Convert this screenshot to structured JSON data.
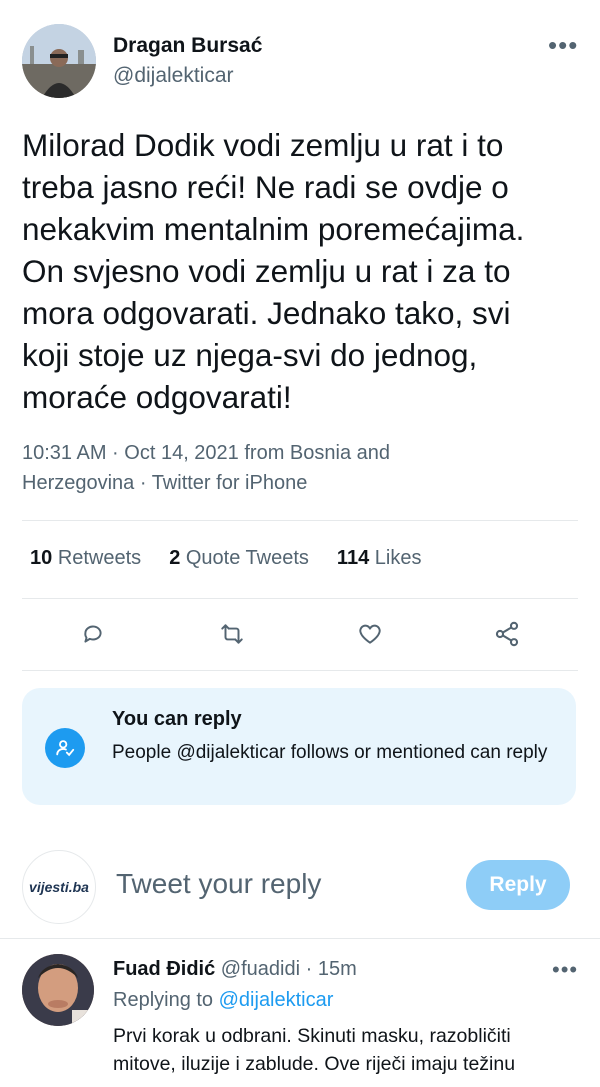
{
  "author": {
    "name": "Dragan Bursać",
    "handle": "@dijalekticar"
  },
  "tweet": {
    "text": "Milorad Dodik vodi zemlju u rat i to\ntreba jasno reći! Ne radi se ovdje o\nnekakvim mentalnim poremećajima.\nOn svjesno vodi zemlju u rat i za to\nmora odgovarati. Jednako tako, svi\nkoji stoje uz njega-svi do jednog,\nmoraće odgovarati!",
    "meta": "10:31 AM · Oct 14, 2021 from Bosnia and\nHerzegovina · Twitter for iPhone"
  },
  "stats": {
    "retweets_count": "10",
    "retweets_label": "Retweets",
    "quotes_count": "2",
    "quotes_label": "Quote Tweets",
    "likes_count": "114",
    "likes_label": "Likes"
  },
  "icons": {
    "reply": "reply-icon",
    "retweet": "retweet-icon",
    "like": "heart-icon",
    "share": "share-icon",
    "more": "more-icon"
  },
  "reply_permissions": {
    "title": "You can reply",
    "description": "People @dijalekticar follows or mentioned can reply"
  },
  "composer": {
    "logo_text": "vijesti.ba",
    "placeholder": "Tweet your reply",
    "button_label": "Reply"
  },
  "reply": {
    "name": "Fuad Đidić",
    "handle": "@fuadidi",
    "time": "· 15m",
    "replying_prefix": "Replying to",
    "replying_to": "@dijalekticar",
    "text": "Prvi korak u odbrani. Skinuti masku, razobličiti\nmitove, iluzije i zablude. Ove riječi imaju težinu"
  },
  "colors": {
    "accent": "#1d9bf0",
    "muted": "#536471",
    "reply_box_bg": "#e8f5fd",
    "button_disabled": "#8ecdf7"
  }
}
